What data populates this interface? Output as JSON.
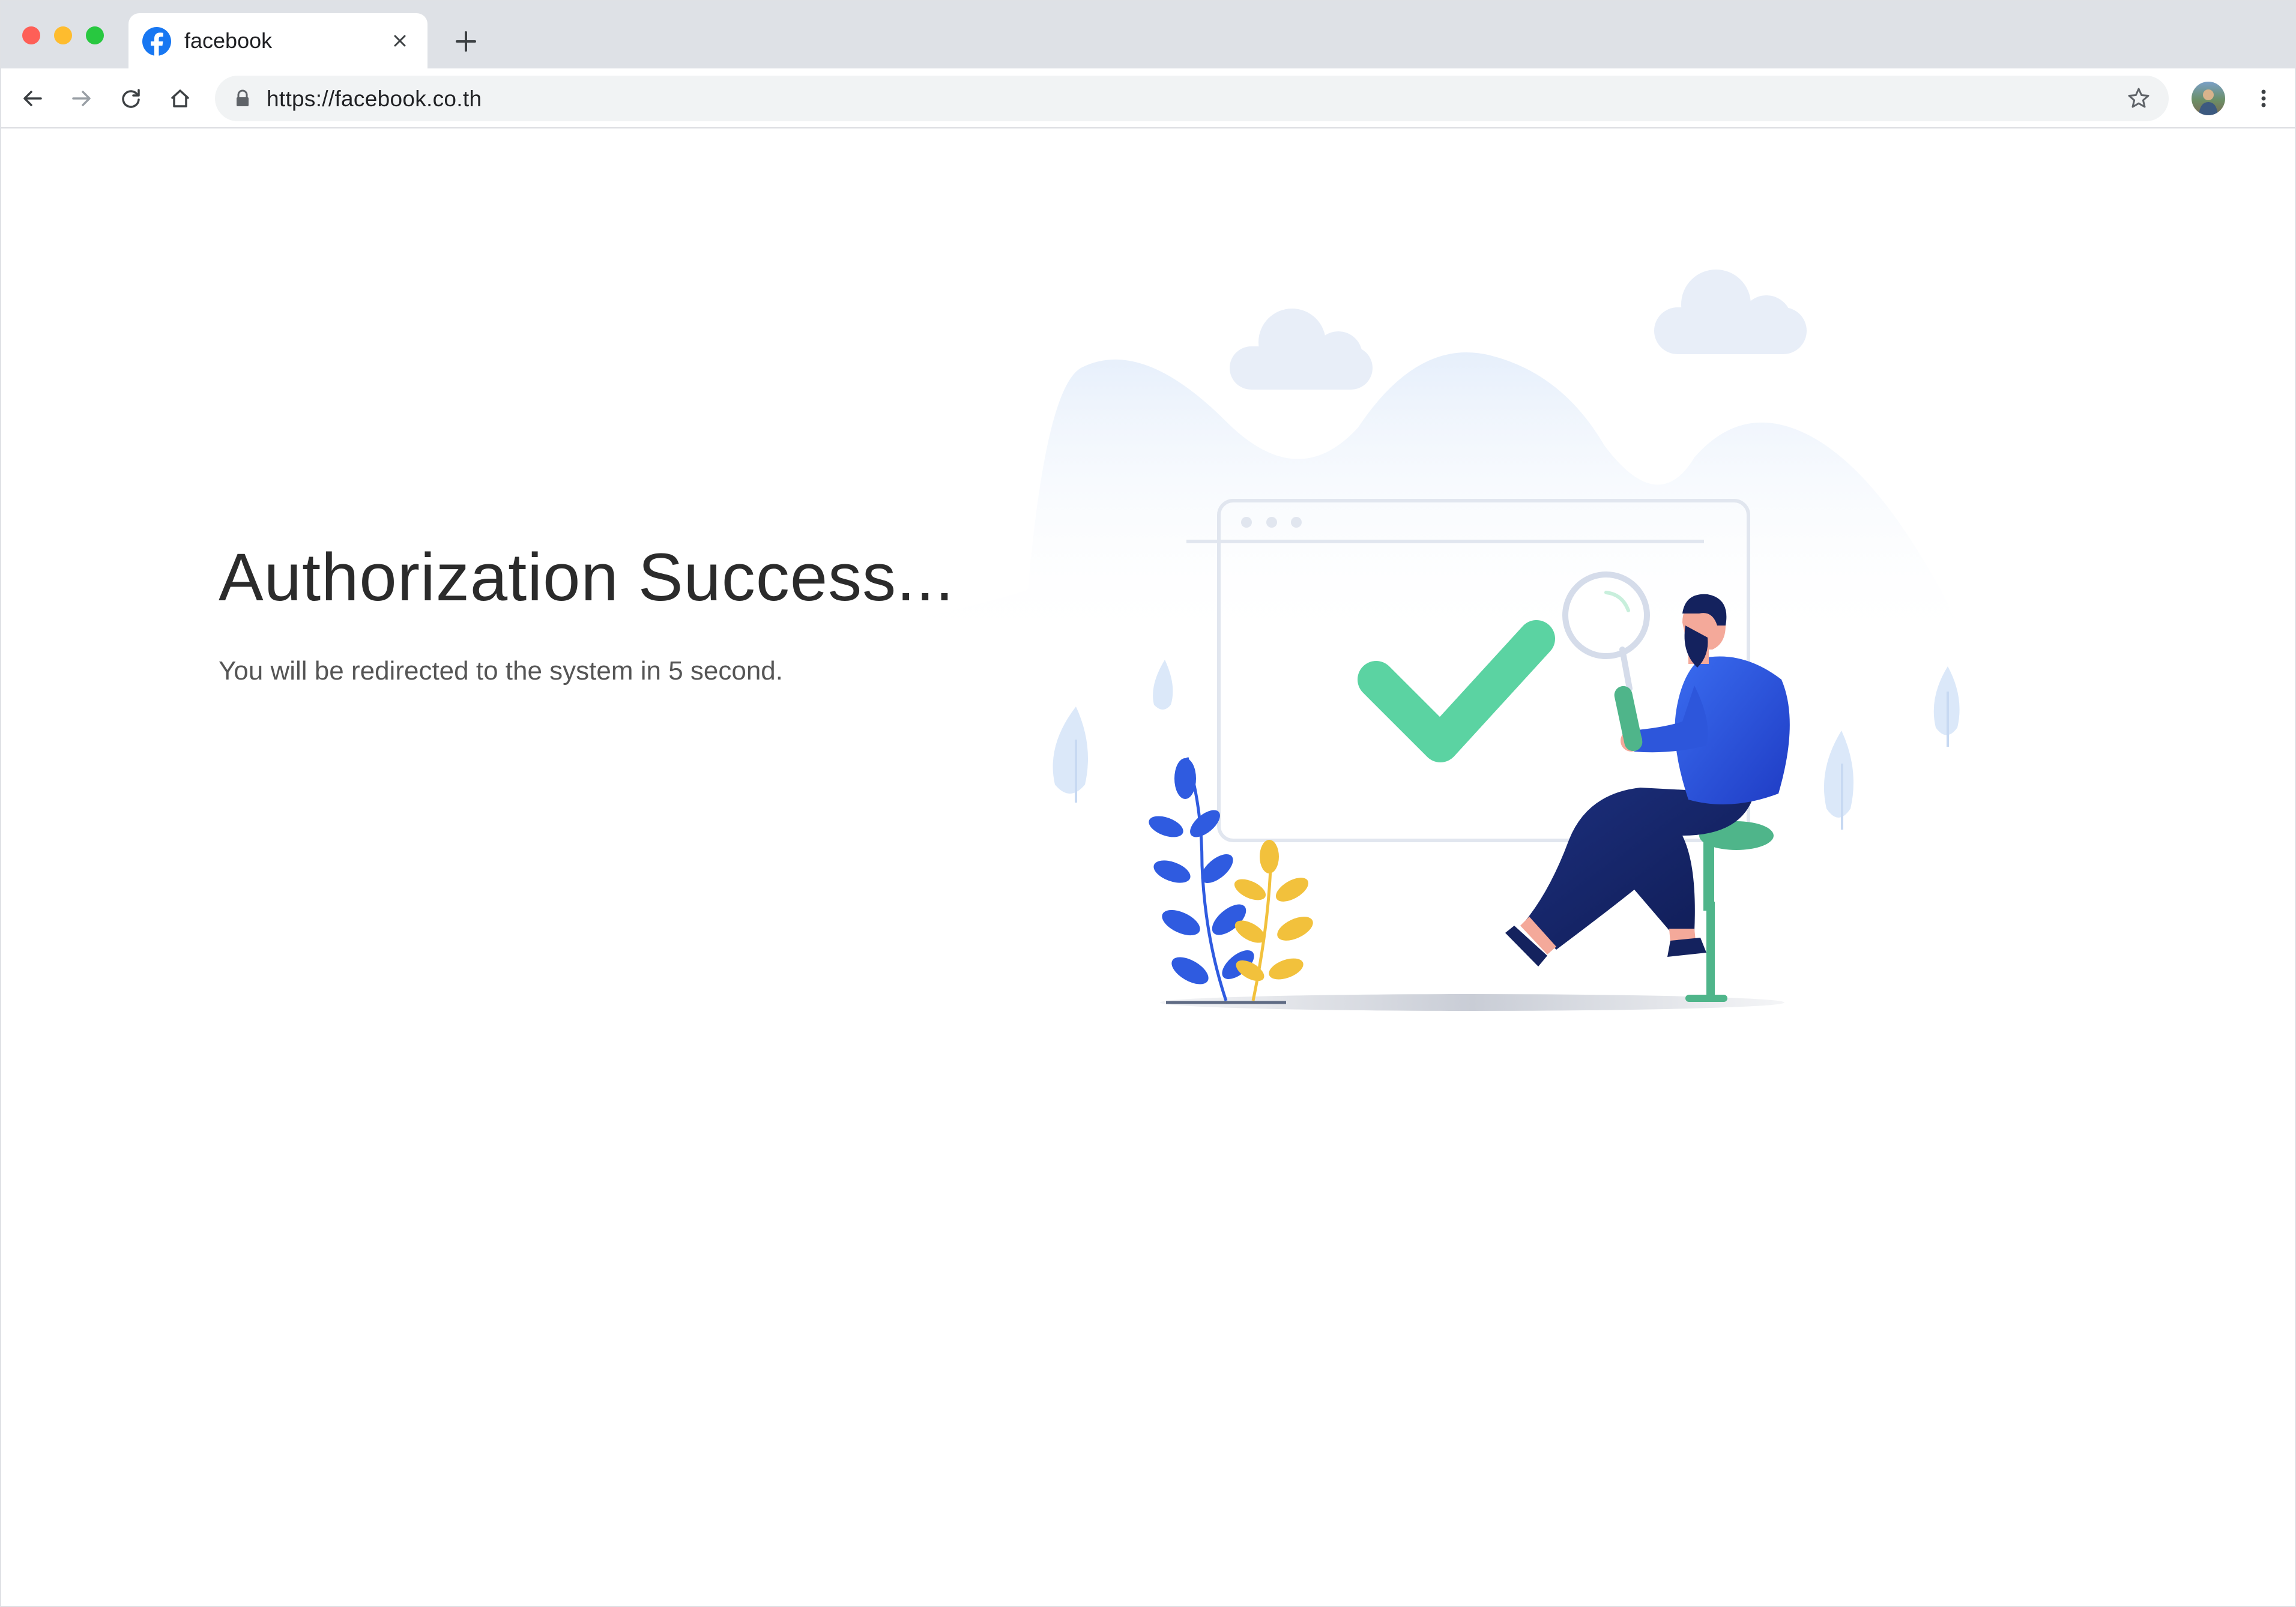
{
  "browser": {
    "tab": {
      "title": "facebook",
      "favicon": "facebook-icon"
    },
    "url": "https://facebook.co.th",
    "icons": [
      "back-arrow-icon",
      "forward-arrow-icon",
      "reload-icon",
      "home-icon",
      "lock-icon",
      "star-icon",
      "kebab-menu-icon",
      "plus-icon",
      "close-icon"
    ]
  },
  "page": {
    "heading": "Authorization Success...",
    "message": "You will be redirected to the system in 5 second."
  },
  "colors": {
    "facebook_blue": "#1877f2",
    "check_green": "#5bd3a2",
    "person_blue": "#2f5be0",
    "navy": "#16296b",
    "leaf_yellow": "#f2c13c",
    "stool_green": "#4fb58a",
    "soft_bg": "#eaf2fc"
  }
}
